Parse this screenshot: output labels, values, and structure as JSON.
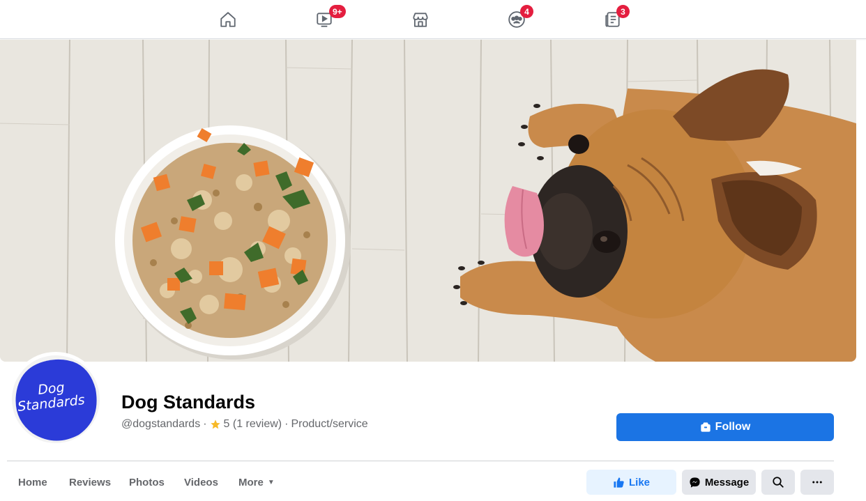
{
  "nav": {
    "items": [
      {
        "name": "home",
        "icon": "home-icon",
        "badge": ""
      },
      {
        "name": "watch",
        "icon": "video-icon",
        "badge": "9+"
      },
      {
        "name": "marketplace",
        "icon": "store-icon",
        "badge": ""
      },
      {
        "name": "groups",
        "icon": "groups-icon",
        "badge": "4"
      },
      {
        "name": "news",
        "icon": "news-feed-icon",
        "badge": "3"
      }
    ],
    "badge_color": "#e41e3f"
  },
  "cover": {
    "icon": "cover-photo-dog-and-food-bowl"
  },
  "avatar": {
    "logo_text_1": "Dog",
    "logo_text_2": "Standards",
    "color": "#2b3bd8"
  },
  "page": {
    "title": "Dog Standards",
    "handle": "@dogstandards",
    "sep": "·",
    "rating": "5 (1 review)",
    "category": "Product/service"
  },
  "follow": {
    "label": "Follow",
    "color": "#1b74e4"
  },
  "tabs": [
    {
      "label": "Home"
    },
    {
      "label": "Reviews"
    },
    {
      "label": "Photos"
    },
    {
      "label": "Videos"
    },
    {
      "label": "More"
    }
  ],
  "actions": {
    "like": "Like",
    "message": "Message",
    "accent": "#1877f2"
  }
}
